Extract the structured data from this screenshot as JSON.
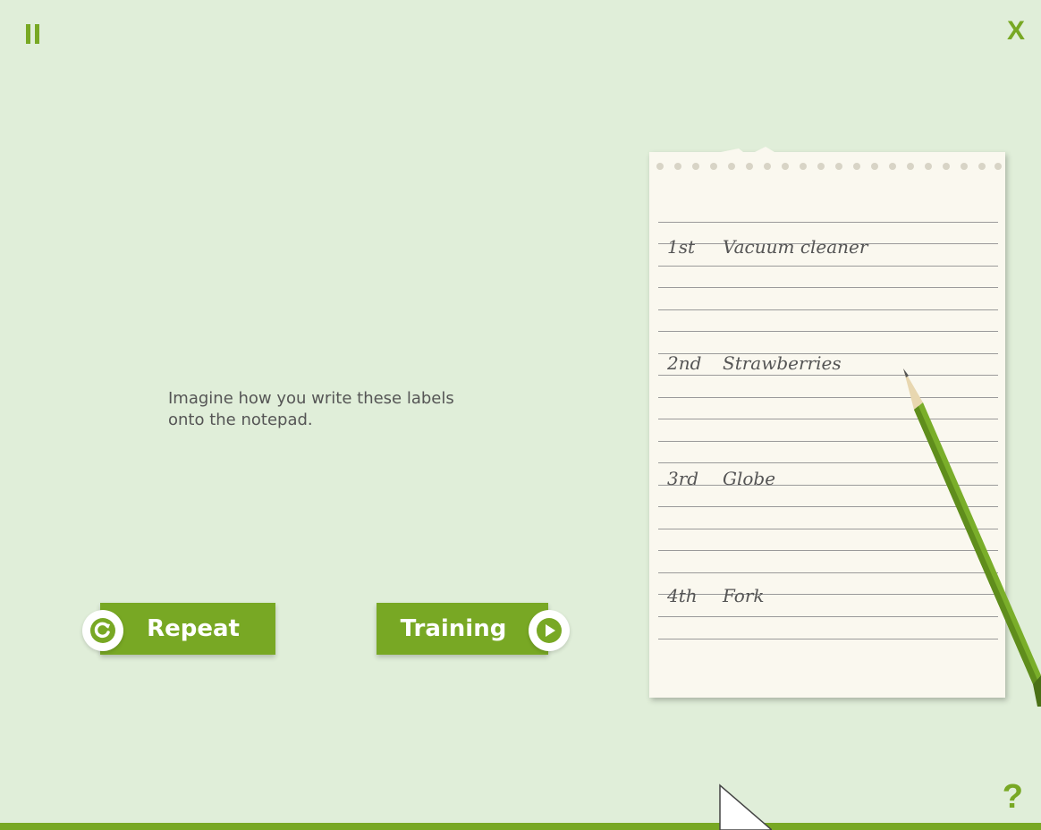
{
  "header": {
    "pause_icon": "pause-icon",
    "close_label": "X"
  },
  "instruction": "Imagine how you write these labels\nonto the notepad.",
  "buttons": {
    "repeat": {
      "label": "Repeat",
      "icon": "repeat-icon"
    },
    "training": {
      "label": "Training",
      "icon": "play-icon"
    }
  },
  "notepad": {
    "entries": [
      {
        "ordinal": "1st",
        "label": "Vacuum cleaner"
      },
      {
        "ordinal": "2nd",
        "label": "Strawberries"
      },
      {
        "ordinal": "3rd",
        "label": "Globe"
      },
      {
        "ordinal": "4th",
        "label": "Fork"
      }
    ]
  },
  "footer": {
    "help_label": "?"
  },
  "colors": {
    "accent": "#78a824",
    "background": "#e0eed9",
    "paper": "#faf8ef"
  }
}
